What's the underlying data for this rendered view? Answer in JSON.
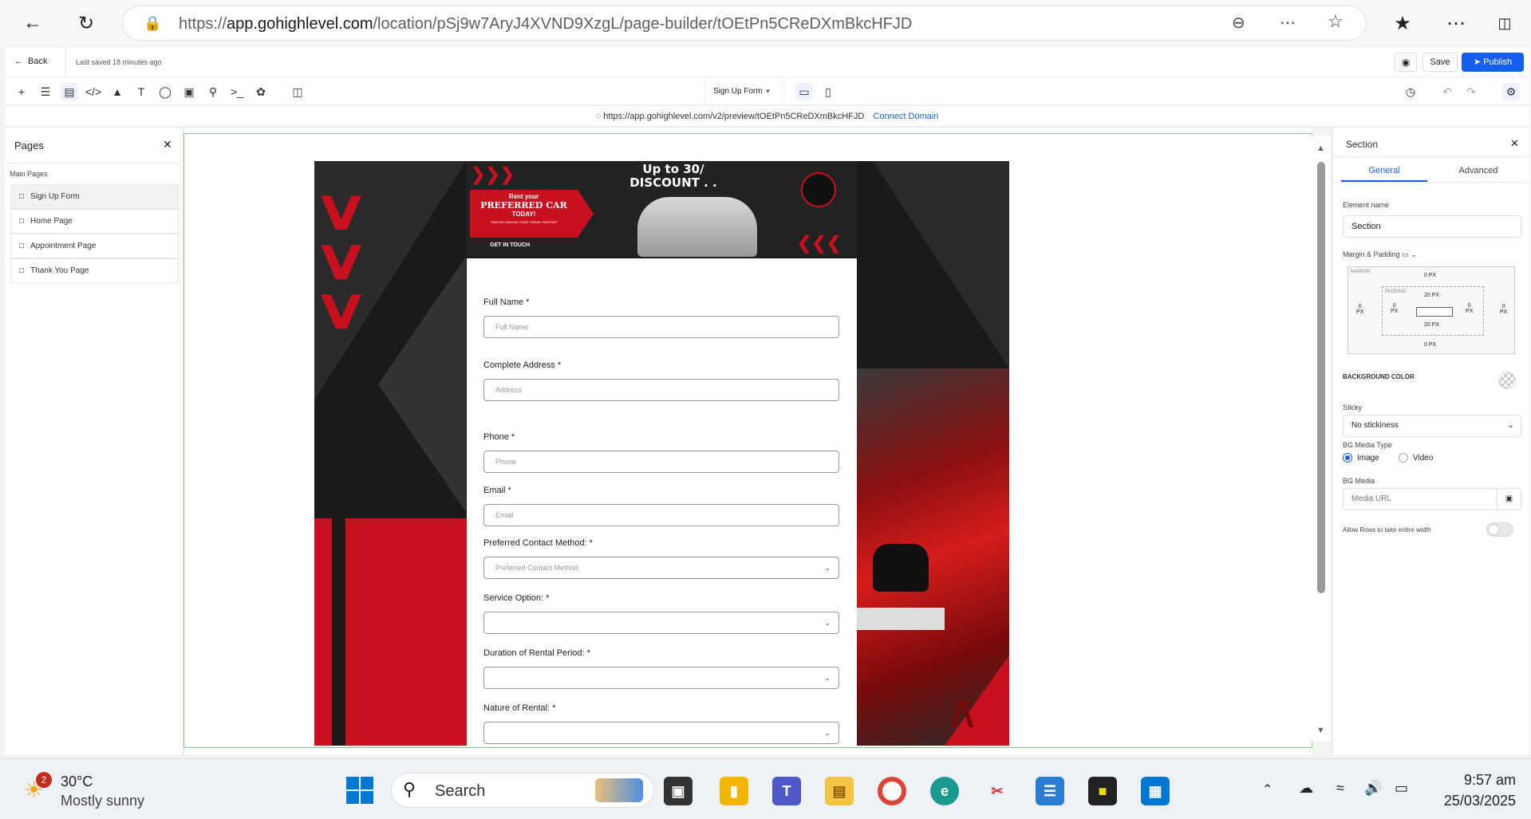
{
  "browser": {
    "url_prefix": "https://",
    "url_domain": "app.gohighlevel.com",
    "url_path": "/location/pSj9w7AryJ4XVND9XzgL/page-builder/tOEtPn5CReDXmBkcHFJD"
  },
  "topbar": {
    "back_label": "Back",
    "last_saved": "Last saved 18 minutes ago",
    "page_selector": "Sign Up Form",
    "save_label": "Save",
    "publish_label": "Publish"
  },
  "preview": {
    "url": "https://app.gohighlevel.com/v2/preview/tOEtPn5CReDXmBkcHFJD",
    "connect_label": "Connect Domain"
  },
  "pages_panel": {
    "title": "Pages",
    "group_label": "Main Pages",
    "items": [
      {
        "label": "Sign Up Form"
      },
      {
        "label": "Home Page"
      },
      {
        "label": "Appointment Page"
      },
      {
        "label": "Thank You Page"
      }
    ]
  },
  "banner": {
    "headline_1": "Up to 30/",
    "headline_2": "DISCOUNT . . .",
    "rent_your": "Rent your",
    "preferred_car": "PREFERRED CAR",
    "today": "TODAY!",
    "tagline": "TWAYNE GARAGE,YOUR TRAVEL PARTNER",
    "get_in_touch": "GET IN TOUCH"
  },
  "form": {
    "fields": [
      {
        "label": "Full Name *",
        "placeholder": "Full Name"
      },
      {
        "label": "Complete Address *",
        "placeholder": "Address"
      },
      {
        "label": "Phone *",
        "placeholder": "Phone"
      },
      {
        "label": "Email *",
        "placeholder": "Email"
      },
      {
        "label": "Preferred Contact Method: *",
        "placeholder": "Preferred Contact Method"
      },
      {
        "label": "Service Option: *",
        "placeholder": ""
      },
      {
        "label": "Duration of Rental Period: *",
        "placeholder": ""
      },
      {
        "label": "Nature of Rental: *",
        "placeholder": ""
      }
    ]
  },
  "right_panel": {
    "title": "Section",
    "tab_general": "General",
    "tab_advanced": "Advanced",
    "element_name_label": "Element name",
    "element_name_value": "Section",
    "margin_padding_label": "Margin & Padding",
    "margin_label": "MARGIN",
    "padding_label": "PADDING",
    "margin_top": "0 PX",
    "margin_bottom": "0 PX",
    "margin_left_val": "0",
    "margin_right_val": "0",
    "padding_top": "20 PX",
    "padding_bottom": "20 PX",
    "padding_left_val": "0",
    "padding_right_val": "0",
    "px_unit": "PX",
    "bg_color_label": "BACKGROUND COLOR",
    "sticky_label": "Sticky",
    "sticky_value": "No stickiness",
    "bg_media_type_label": "BG Media Type",
    "bg_media_image": "Image",
    "bg_media_video": "Video",
    "bg_media_label": "BG Media",
    "media_url_placeholder": "Media URL",
    "allow_rows_label": "Allow Rows to take entire width"
  },
  "taskbar": {
    "weather_temp": "30°C",
    "weather_desc": "Mostly sunny",
    "weather_badge": "2",
    "search_label": "Search",
    "time": "9:57 am",
    "date": "25/03/2025"
  },
  "colors": {
    "accent": "#155eef",
    "brand_red": "#c8101e",
    "canvas_border": "#7dd87d"
  }
}
